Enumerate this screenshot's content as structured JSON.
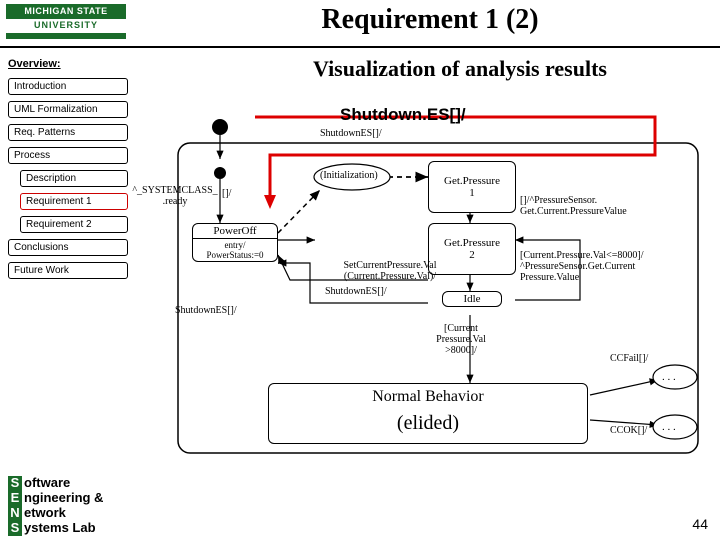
{
  "header": {
    "logo_top": "MICHIGAN STATE",
    "logo_bot": "UNIVERSITY",
    "title": "Requirement 1 (2)"
  },
  "sidebar": {
    "heading": "Overview:",
    "items": [
      {
        "label": "Introduction",
        "indent": false,
        "active": false
      },
      {
        "label": "UML Formalization",
        "indent": false,
        "active": false
      },
      {
        "label": "Req. Patterns",
        "indent": false,
        "active": false
      },
      {
        "label": "Process",
        "indent": false,
        "active": false
      },
      {
        "label": "Description",
        "indent": true,
        "active": false
      },
      {
        "label": "Requirement 1",
        "indent": true,
        "active": true
      },
      {
        "label": "Requirement 2",
        "indent": true,
        "active": false
      },
      {
        "label": "Conclusions",
        "indent": false,
        "active": false
      },
      {
        "label": "Future Work",
        "indent": false,
        "active": false
      }
    ]
  },
  "main": {
    "subtitle": "Visualization of analysis results",
    "red_callout": "Shutdown.ES[]/",
    "states": {
      "poweroff": {
        "name": "PowerOff",
        "action": "entry/\nPowerStatus:=0"
      },
      "getpressure1": {
        "name": "Get.Pressure\n1"
      },
      "getpressure2": {
        "name": "Get.Pressure\n2"
      },
      "idle": {
        "name": "Idle"
      },
      "normal": {
        "name": "Normal Behavior",
        "elided": "(elided)"
      }
    },
    "labels": {
      "top_shutdown": "ShutdownES[]/",
      "systemclass": "^_SYSTEMCLASS_\n.ready",
      "init_paren": "(Initialization)",
      "after_gp1": "[]/^PressureSensor.\nGet.Current.PressureValue",
      "setcurrent": "SetCurrentPressure.Val\n(Current.Pressure.Val)/",
      "after_idle": "[Current.Pressure.Val<=8000]/\n^PressureSensor.Get.Current\nPressure.Value",
      "shutdown_left": "ShutdownES[]/",
      "shutdown_mid": "ShutdownES[]/",
      "guard_down": "[Current\nPressure.Val\n>8000]/",
      "ccfail": "CCFail[]/",
      "ccok": "CCOK[]/",
      "empty_guard": "[]/"
    },
    "ellipsis": ". . ."
  },
  "footer": {
    "lab_lines": [
      {
        "big": "S",
        "rest": "oftware"
      },
      {
        "big": "E",
        "rest": "ngineering &"
      },
      {
        "big": "N",
        "rest": "etwork"
      },
      {
        "big": "S",
        "rest": "ystems Lab"
      }
    ],
    "page": "44"
  }
}
